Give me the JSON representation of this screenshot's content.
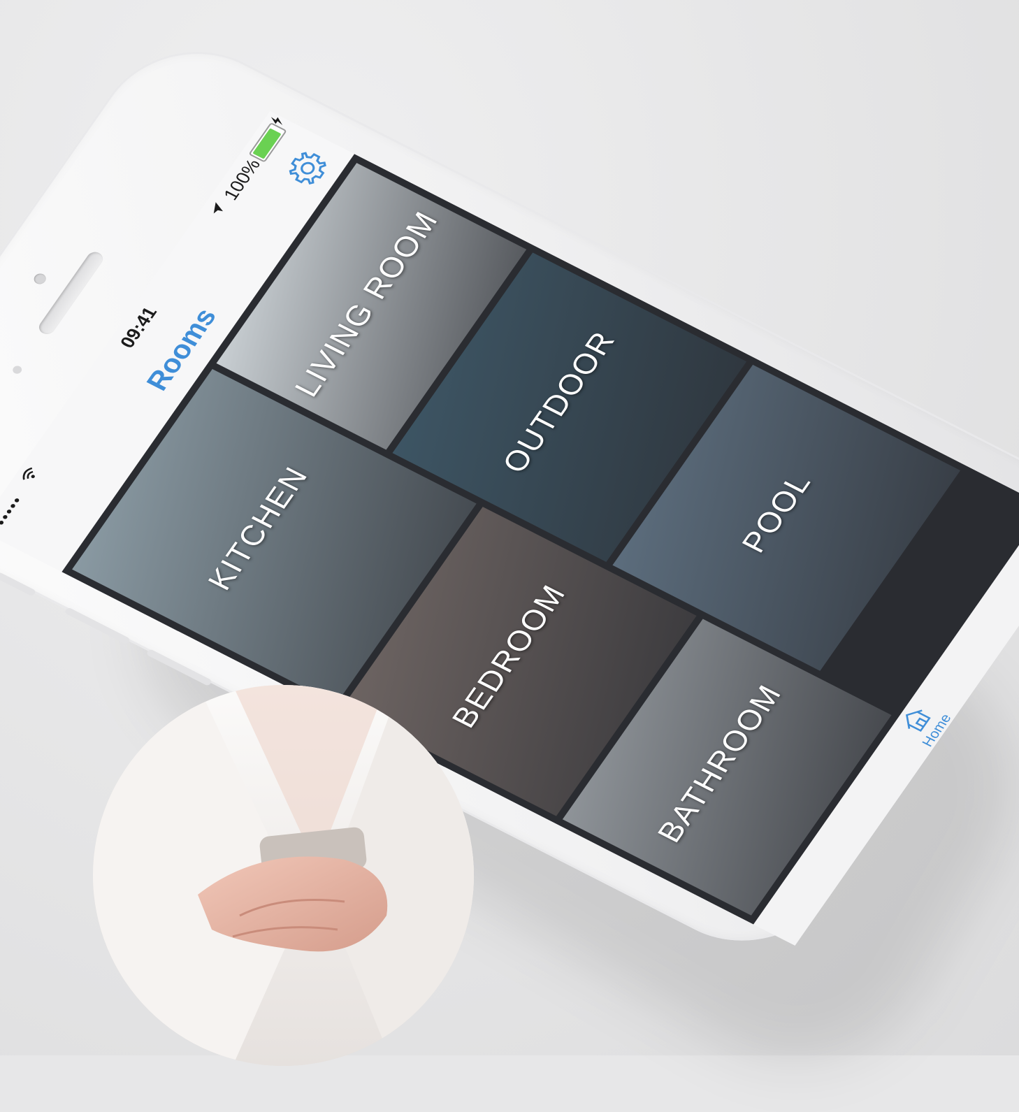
{
  "status_bar": {
    "signal_dots": "•••••",
    "wifi_icon": "wifi-icon",
    "time": "09:41",
    "location_icon": "location-arrow-icon",
    "battery_percent": "100%",
    "battery_level": 1.0,
    "charging_icon": "bolt-icon"
  },
  "nav": {
    "title": "Rooms",
    "settings_icon": "gear-icon"
  },
  "rooms": [
    {
      "label": "KITCHEN",
      "color": "#8a9aa3"
    },
    {
      "label": "LIVING ROOM",
      "color": "#c9cfd3"
    },
    {
      "label": "OUTDOOR",
      "color": "#3d5564"
    },
    {
      "label": "BEDROOM",
      "color": "#6d6462"
    },
    {
      "label": "POOL",
      "color": "#5c6d7d"
    },
    {
      "label": "BATHROOM",
      "color": "#8f9499"
    }
  ],
  "tab_bar": {
    "home_label": "Home",
    "home_icon": "home-icon"
  },
  "colors": {
    "accent": "#3f8ed8",
    "grid_background": "#2a2c31",
    "device_white": "#f7f7f8"
  }
}
